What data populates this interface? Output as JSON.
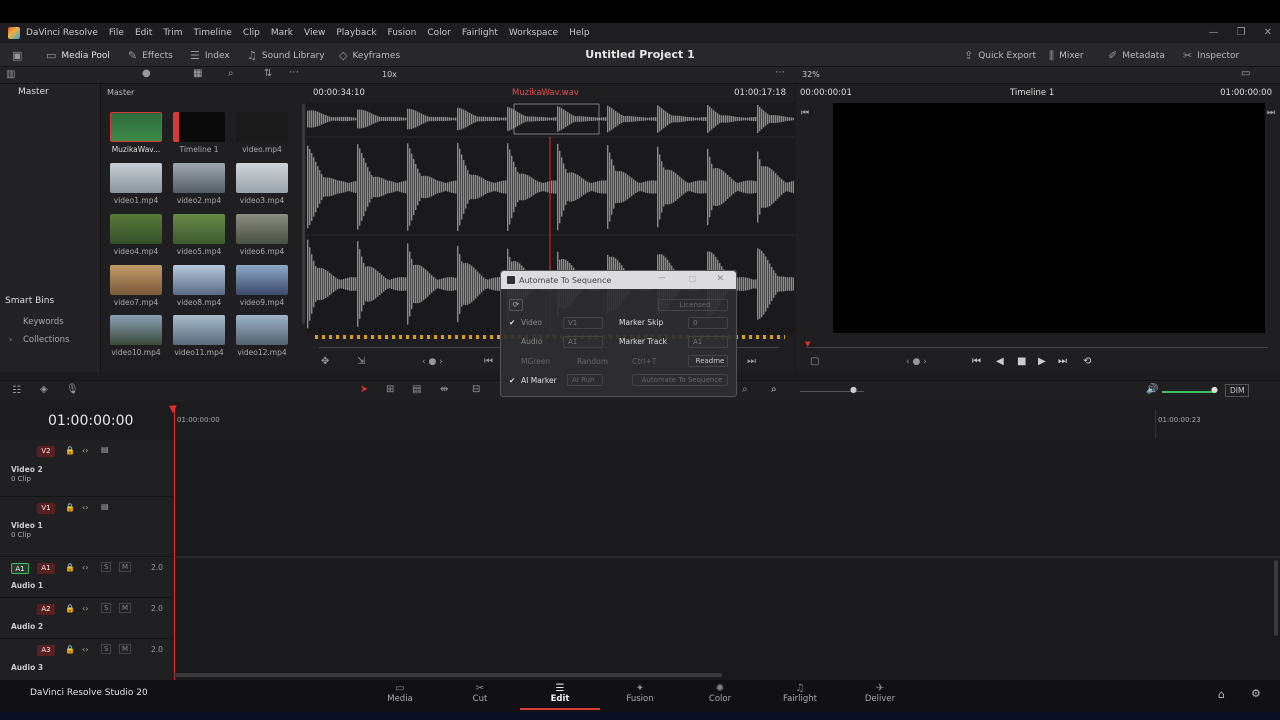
{
  "app": {
    "name": "DaVinci Resolve",
    "edition": "DaVinci Resolve Studio 20"
  },
  "menu": [
    "File",
    "Edit",
    "Trim",
    "Timeline",
    "Clip",
    "Mark",
    "View",
    "Playback",
    "Fusion",
    "Color",
    "Fairlight",
    "Workspace",
    "Help"
  ],
  "toolbar": {
    "media_pool": "Media Pool",
    "effects": "Effects",
    "index": "Index",
    "sound_library": "Sound Library",
    "keyframes": "Keyframes",
    "project_title": "Untitled Project 1",
    "quick_export": "Quick Export",
    "mixer": "Mixer",
    "metadata": "Metadata",
    "inspector": "Inspector"
  },
  "subbar": {
    "zoom": "10x",
    "viewer_zoom": "32%"
  },
  "bins": {
    "master": "Master",
    "smart_bins": "Smart Bins",
    "keywords": "Keywords",
    "collections": "Collections"
  },
  "pool": {
    "header": "Master",
    "clips": [
      {
        "name": "MuzikaWav...",
        "kind": "audio"
      },
      {
        "name": "Timeline 1",
        "kind": "timeline"
      },
      {
        "name": "video.mp4",
        "kind": "video"
      },
      {
        "name": "video1.mp4"
      },
      {
        "name": "video2.mp4"
      },
      {
        "name": "video3.mp4"
      },
      {
        "name": "video4.mp4"
      },
      {
        "name": "video5.mp4"
      },
      {
        "name": "video6.mp4"
      },
      {
        "name": "video7.mp4"
      },
      {
        "name": "video8.mp4"
      },
      {
        "name": "video9.mp4"
      },
      {
        "name": "video10.mp4"
      },
      {
        "name": "video11.mp4"
      },
      {
        "name": "video12.mp4"
      }
    ]
  },
  "source": {
    "timecode_left": "00:00:34:10",
    "clip_name": "MuzikaWav.wav",
    "timecode_right": "01:00:17:18"
  },
  "record": {
    "timecode_left": "00:00:00:01",
    "timeline_name": "Timeline 1",
    "timecode_right": "01:00:00:00"
  },
  "timeline": {
    "timecode": "01:00:00:00",
    "ruler_start": "01:00:00:00",
    "ruler_end": "01:00:00:23",
    "dim": "DIM"
  },
  "tracks": [
    {
      "badge": "V2",
      "name": "Video 2",
      "sub": "0 Clip"
    },
    {
      "badge": "V1",
      "name": "Video 1",
      "sub": "0 Clip"
    },
    {
      "badge": "A1",
      "name": "Audio 1",
      "level": "2.0"
    },
    {
      "badge": "A2",
      "name": "Audio 2",
      "level": "2.0"
    },
    {
      "badge": "A3",
      "name": "Audio 3",
      "level": "2.0"
    }
  ],
  "dialog": {
    "title": "Automate To Sequence",
    "licensed": "Licensed",
    "video": "Video",
    "video_track": "V1",
    "marker_skip": "Marker Skip",
    "marker_skip_val": "0",
    "audio": "Audio",
    "audio_track": "A1",
    "marker_track": "Marker Track",
    "marker_track_val": "A1",
    "mgreen": "MGreen",
    "random": "Random",
    "ctrl_t": "Ctrl+T",
    "readme": "Readme",
    "ai_marker": "AI Marker",
    "ai_run": "AI Run",
    "automate": "Automate To Sequence"
  },
  "pages": [
    "Media",
    "Cut",
    "Edit",
    "Fusion",
    "Color",
    "Fairlight",
    "Deliver"
  ],
  "colors": {
    "accent": "#d83a3a",
    "playhead": "#e03030",
    "active_page": "#e8e8e8"
  }
}
